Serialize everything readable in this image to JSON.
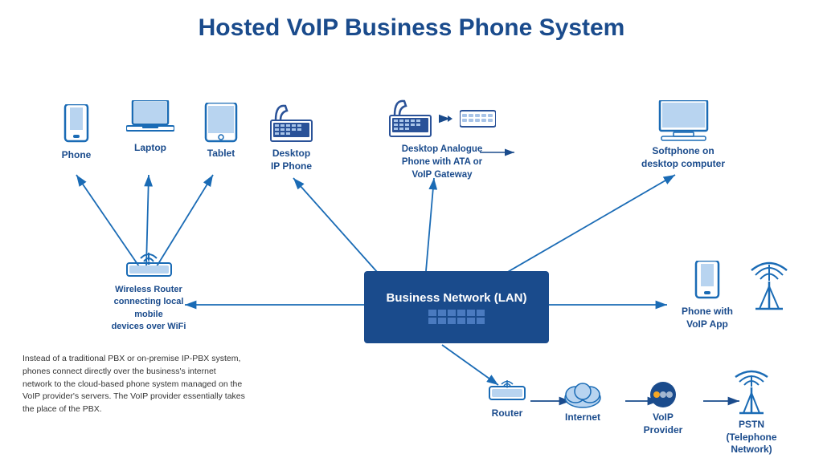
{
  "title": "Hosted VoIP Business Phone System",
  "devices": {
    "phone": "Phone",
    "laptop": "Laptop",
    "tablet": "Tablet",
    "desktop_ip": "Desktop\nIP Phone",
    "desktop_analogue": "Desktop Analogue\nPhone with ATA or\nVoIP Gateway",
    "softphone": "Softphone on\ndesktop computer",
    "wireless_router": "Wireless Router\nconnecting local mobile\ndevices over WiFi",
    "phone_voip": "Phone with\nVoIP App",
    "business_network": "Business Network (LAN)",
    "router": "Router",
    "internet": "Internet",
    "voip_provider": "VoIP\nProvider",
    "pstn": "PSTN\n(Telephone\nNetwork)"
  },
  "note": "Instead of a traditional PBX or on-premise IP-PBX system, phones connect directly over the business's internet network to the cloud-based phone system managed on the VoIP provider's servers. The VoIP provider essentially takes the place of the PBX."
}
